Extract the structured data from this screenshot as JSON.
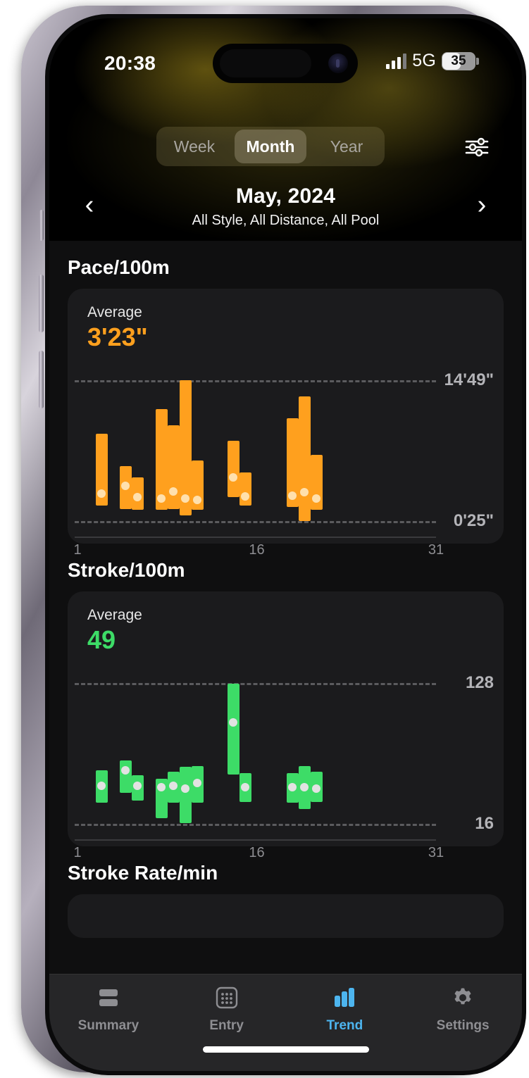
{
  "status_bar": {
    "time": "20:38",
    "network": "5G",
    "battery": "35"
  },
  "header": {
    "segments": [
      {
        "label": "Week",
        "active": false
      },
      {
        "label": "Month",
        "active": true
      },
      {
        "label": "Year",
        "active": false
      }
    ],
    "filter_icon": "sliders-icon",
    "prev_icon": "‹",
    "next_icon": "›",
    "title": "May, 2024",
    "subtitle": "All Style, All Distance, All Pool"
  },
  "sections": [
    {
      "heading": "Pace/100m",
      "average_label": "Average",
      "average_value": "3'23\"",
      "color": "#ffa01e"
    },
    {
      "heading": "Stroke/100m",
      "average_label": "Average",
      "average_value": "49",
      "color": "#3ddc67"
    },
    {
      "heading": "Stroke Rate/min"
    }
  ],
  "chart_data": [
    {
      "type": "bar",
      "title": "Pace/100m",
      "subtitle": "Average 3'23\"",
      "color": "#ffa01e",
      "dot_color": "#ffe0ad",
      "xlabel": "",
      "ylabel": "",
      "grid": true,
      "axis_top_label": "14'49\"",
      "axis_bottom_label": "0'25\"",
      "ylim_top_seconds": 889,
      "ylim_bottom_seconds": 25,
      "x_ticks": [
        "1",
        "16",
        "31"
      ],
      "x_tick_positions": [
        1,
        16,
        31
      ],
      "bars": [
        {
          "day": 3,
          "high": 0.618,
          "low": 0.108,
          "avg": 0.193
        },
        {
          "day": 5,
          "high": 0.388,
          "low": 0.085,
          "avg": 0.248
        },
        {
          "day": 6,
          "high": 0.31,
          "low": 0.08,
          "avg": 0.168
        },
        {
          "day": 8,
          "high": 0.795,
          "low": 0.082,
          "avg": 0.16
        },
        {
          "day": 9,
          "high": 0.678,
          "low": 0.085,
          "avg": 0.21
        },
        {
          "day": 10,
          "high": 1.0,
          "low": 0.042,
          "avg": 0.162
        },
        {
          "day": 11,
          "high": 0.432,
          "low": 0.08,
          "avg": 0.152
        },
        {
          "day": 14,
          "high": 0.57,
          "low": 0.168,
          "avg": 0.312
        },
        {
          "day": 15,
          "high": 0.345,
          "low": 0.11,
          "avg": 0.173
        },
        {
          "day": 19,
          "high": 0.73,
          "low": 0.098,
          "avg": 0.18
        },
        {
          "day": 20,
          "high": 0.885,
          "low": 0.0,
          "avg": 0.205
        },
        {
          "day": 21,
          "high": 0.47,
          "low": 0.078,
          "avg": 0.158
        }
      ]
    },
    {
      "type": "bar",
      "title": "Stroke/100m",
      "subtitle": "Average 49",
      "color": "#3ddc67",
      "dot_color": "#e2e2e2",
      "xlabel": "",
      "ylabel": "",
      "grid": true,
      "axis_top_label": "128",
      "axis_bottom_label": "16",
      "ylim": [
        16,
        128
      ],
      "x_ticks": [
        "1",
        "16",
        "31"
      ],
      "x_tick_positions": [
        1,
        16,
        31
      ],
      "bars": [
        {
          "day": 3,
          "high": 0.38,
          "low": 0.148,
          "avg": 0.272
        },
        {
          "day": 5,
          "high": 0.452,
          "low": 0.222,
          "avg": 0.382
        },
        {
          "day": 6,
          "high": 0.345,
          "low": 0.165,
          "avg": 0.268
        },
        {
          "day": 8,
          "high": 0.318,
          "low": 0.038,
          "avg": 0.262
        },
        {
          "day": 9,
          "high": 0.368,
          "low": 0.152,
          "avg": 0.268
        },
        {
          "day": 10,
          "high": 0.405,
          "low": 0.005,
          "avg": 0.252
        },
        {
          "day": 11,
          "high": 0.408,
          "low": 0.15,
          "avg": 0.288
        },
        {
          "day": 14,
          "high": 0.995,
          "low": 0.352,
          "avg": 0.718
        },
        {
          "day": 15,
          "high": 0.358,
          "low": 0.155,
          "avg": 0.258
        },
        {
          "day": 19,
          "high": 0.36,
          "low": 0.152,
          "avg": 0.262
        },
        {
          "day": 20,
          "high": 0.408,
          "low": 0.105,
          "avg": 0.258
        },
        {
          "day": 21,
          "high": 0.368,
          "low": 0.155,
          "avg": 0.252
        }
      ]
    }
  ],
  "tabbar": {
    "items": [
      {
        "label": "Summary",
        "icon": "list-icon",
        "active": false
      },
      {
        "label": "Entry",
        "icon": "keypad-icon",
        "active": false
      },
      {
        "label": "Trend",
        "icon": "bar-chart-icon",
        "active": true
      },
      {
        "label": "Settings",
        "icon": "gear-icon",
        "active": false
      }
    ],
    "active_color": "#4db5ef"
  }
}
